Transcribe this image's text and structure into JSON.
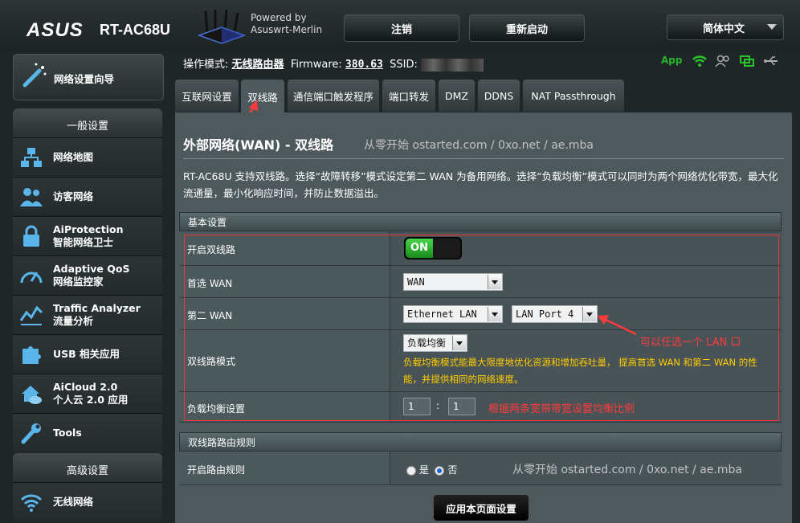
{
  "header": {
    "logo": "ASUS",
    "model": "RT-AC68U",
    "powered_line1": "Powered by",
    "powered_line2": "Asuswrt-Merlin",
    "logout": "注销",
    "reboot": "重新启动",
    "language": "简体中文"
  },
  "sidebar": {
    "wizard": "网络设置向导",
    "general_title": "一般设置",
    "general_items": [
      {
        "label": "网络地图",
        "icon": "network-map-icon"
      },
      {
        "label": "访客网络",
        "icon": "guest-network-icon"
      },
      {
        "label": "AiProtection",
        "sub": "智能网络卫士",
        "icon": "lock-icon"
      },
      {
        "label": "Adaptive QoS",
        "sub": "网络监控家",
        "icon": "speedometer-icon"
      },
      {
        "label": "Traffic Analyzer",
        "sub": "流量分析",
        "icon": "chart-icon"
      },
      {
        "label": "USB 相关应用",
        "icon": "puzzle-icon"
      },
      {
        "label": "AiCloud 2.0",
        "sub": "个人云 2.0 应用",
        "icon": "cloud-house-icon"
      },
      {
        "label": "Tools",
        "icon": "wrench-icon"
      }
    ],
    "advanced_title": "高级设置",
    "advanced_items": [
      {
        "label": "无线网络",
        "icon": "wifi-icon"
      }
    ]
  },
  "status_bar": {
    "mode_label": "操作模式:",
    "mode_value": "无线路由器",
    "firmware_label": "Firmware:",
    "firmware_value": "380.63",
    "ssid_label": "SSID:",
    "app_label": "App"
  },
  "tabs": [
    "互联网设置",
    "双线路",
    "通信端口触发程序",
    "端口转发",
    "DMZ",
    "DDNS",
    "NAT Passthrough"
  ],
  "page": {
    "title": "外部网络(WAN) - 双线路",
    "watermark": "从零开始 ostarted.com / 0xo.net / ae.mba",
    "description": "RT-AC68U 支持双线路。选择“故障转移”模式设定第二 WAN 为备用网络。选择“负载均衡”模式可以同时为两个网络优化带宽，最大化流通量，最小化响应时间，并防止数据溢出。"
  },
  "basic": {
    "section_title": "基本设置",
    "enable_label": "开启双线路",
    "enable_value": "ON",
    "primary_label": "首选 WAN",
    "primary_value": "WAN",
    "secondary_label": "第二 WAN",
    "secondary_value": "Ethernet LAN",
    "secondary_port": "LAN Port 4",
    "mode_label": "双线路模式",
    "mode_value": "负载均衡",
    "mode_hint": "负载均衡模式能最大限度地优化资源和增加吞吐量， 提高首选 WAN 和第二 WAN 的性能，并提供相同的网络速度。",
    "ratio_label": "负载均衡设置",
    "ratio_a": "1",
    "ratio_sep": ":",
    "ratio_b": "1"
  },
  "annotations": {
    "lan_note": "可以任选一个 LAN 口",
    "ratio_note": "根据两条宽带带宽设置均衡比例"
  },
  "routing": {
    "section_title": "双线路路由规则",
    "enable_label": "开启路由规则",
    "yes": "是",
    "no": "否",
    "selected": "否",
    "watermark": "从零开始 ostarted.com / 0xo.net / ae.mba"
  },
  "apply_button": "应用本页面设置",
  "colors": {
    "accent_green": "#29b32a",
    "annotation_red": "#ff3b3b",
    "hint_yellow": "#ffcc00",
    "icon_blue": "#5ab6ea"
  }
}
